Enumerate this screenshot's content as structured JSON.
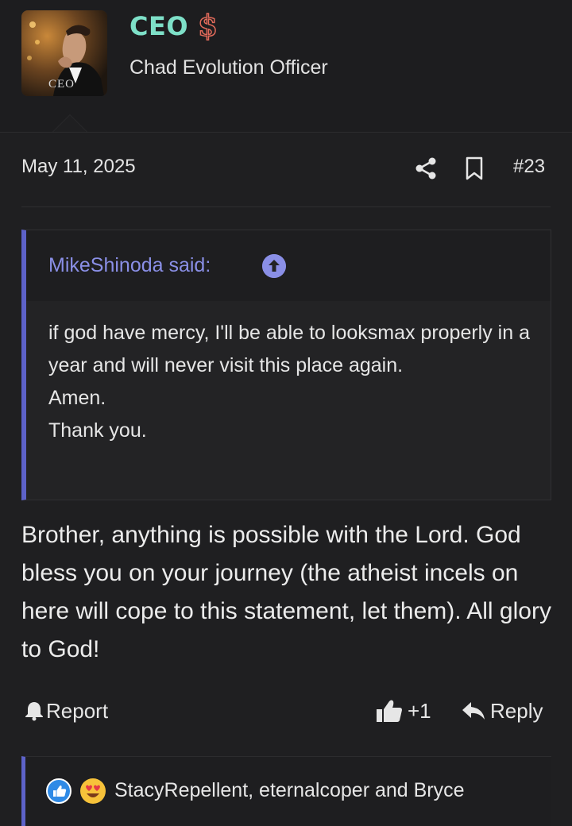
{
  "user": {
    "title": "CEO",
    "subtitle": "Chad Evolution Officer",
    "avatar_badge": "CEO",
    "title_color": "#7ee0c8",
    "title_icon": "dollar-sign-icon"
  },
  "post": {
    "date": "May 11, 2025",
    "number": "#23",
    "body": "Brother, anything is possible with the Lord. God bless you on your journey (the atheist incels on here will cope to this statement, let them). All glory to God!"
  },
  "quote": {
    "author": "MikeShinoda said:",
    "lines": [
      "if god have mercy, I'll be able to looksmax properly in a year and will never visit this place again.",
      "Amen.",
      "Thank you."
    ],
    "accent": "#5d62c9",
    "author_color": "#8a8fe6"
  },
  "actions": {
    "report": "Report",
    "like_count": "+1",
    "reply": "Reply"
  },
  "reactions": {
    "icons": [
      "like-icon",
      "heart-eyes-icon"
    ],
    "text": "StacyRepellent, eternalcoper and Bryce"
  },
  "icons": [
    "share-icon",
    "bookmark-icon",
    "bell-icon",
    "thumbs-up-icon",
    "reply-arrow-icon",
    "arrow-up-circle-icon"
  ]
}
